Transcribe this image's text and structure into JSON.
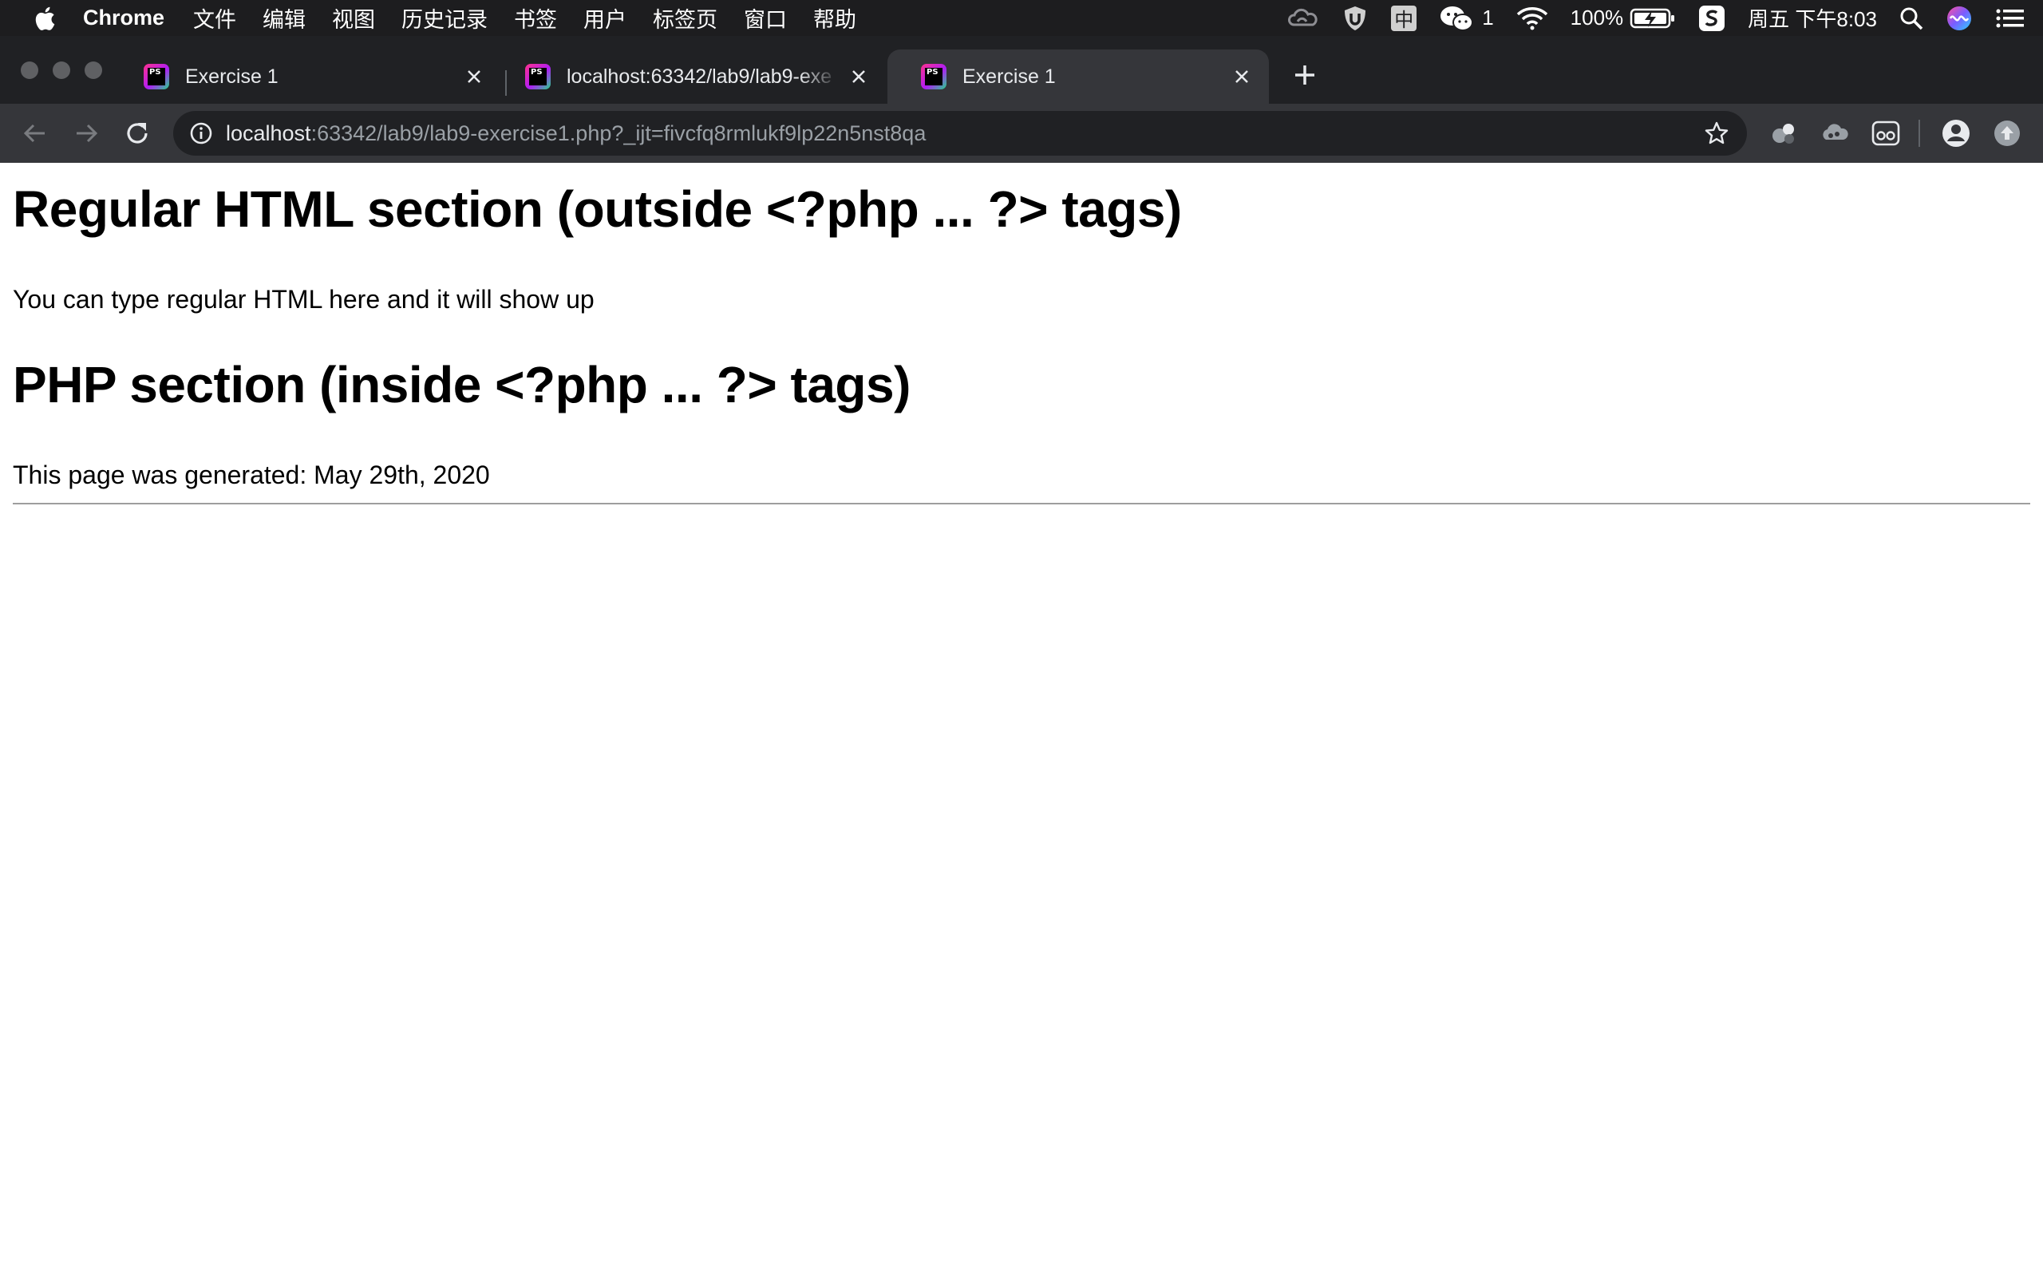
{
  "menubar": {
    "app_name": "Chrome",
    "items": [
      "文件",
      "编辑",
      "视图",
      "历史记录",
      "书签",
      "用户",
      "标签页",
      "窗口",
      "帮助"
    ],
    "input_method": "中",
    "wechat_badge": "1",
    "battery": "100%",
    "clock": "周五 下午8:03"
  },
  "tabs": [
    {
      "title": "Exercise 1",
      "active": false
    },
    {
      "title": "localhost:63342/lab9/lab9-exe",
      "active": false
    },
    {
      "title": "Exercise 1",
      "active": true
    }
  ],
  "favicon_text": "PS",
  "omnibox": {
    "host": "localhost",
    "path": ":63342/lab9/lab9-exercise1.php?_ijt=fivcfq8rmlukf9lp22n5nst8qa"
  },
  "page": {
    "heading_html": "Regular HTML section (outside <?php ... ?> tags)",
    "html_text": "You can type regular HTML here and it will show up",
    "heading_php": "PHP section (inside <?php ... ?> tags)",
    "generated_text": "This page was generated: May 29th, 2020"
  },
  "colors": {
    "menubar_bg": "#1d1d1f",
    "tabstrip_bg": "#202124",
    "active_tab_bg": "#35363a",
    "omnibox_bg": "#202124"
  }
}
